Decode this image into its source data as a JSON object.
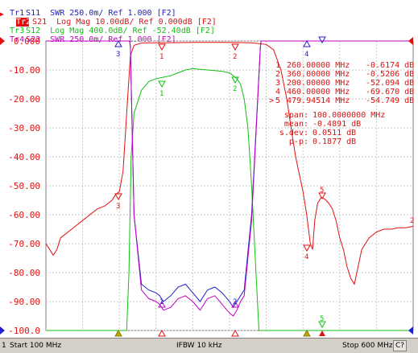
{
  "traces": [
    {
      "id": "Tr1",
      "text": "S11  SWR 250.0m/ Ref 1.000 [F2]",
      "color": "#2020d0",
      "active": false
    },
    {
      "id": "Tr2",
      "text": "S21  Log Mag 10.00dB/ Ref 0.000dB [F2]",
      "color": "#e01010",
      "active": true
    },
    {
      "id": "Tr3",
      "text": "S12  Log Mag 400.0dB/ Ref -52.40dB [F2]",
      "color": "#10c010",
      "active": false
    },
    {
      "id": "Tr4",
      "text": "S22  SWR 250.0m/ Ref 1.000 [F2]",
      "color": "#c000c0",
      "active": false
    }
  ],
  "y_axis": {
    "labels": [
      "0.000",
      "-10.00",
      "-20.00",
      "-30.00",
      "-40.00",
      "-50.00",
      "-60.00",
      "-70.00",
      "-80.00",
      "-90.00",
      "-100.0"
    ],
    "values": [
      0,
      -10,
      -20,
      -30,
      -40,
      -50,
      -60,
      -70,
      -80,
      -90,
      -100
    ]
  },
  "markers": [
    {
      "num": "1",
      "freq": "260.00000 MHz",
      "value": "-0.6174 dB",
      "prefix": ""
    },
    {
      "num": "2",
      "freq": "360.00000 MHz",
      "value": "-0.5206 dB",
      "prefix": ""
    },
    {
      "num": "3",
      "freq": "200.00000 MHz",
      "value": "-52.094 dB",
      "prefix": ""
    },
    {
      "num": "4",
      "freq": "460.00000 MHz",
      "value": "-69.670 dB",
      "prefix": ""
    },
    {
      "num": "5",
      "freq": "479.94514 MHz",
      "value": "-54.749 dB",
      "prefix": ">"
    }
  ],
  "stats": [
    {
      "label": "span:",
      "value": "100.0000000 MHz"
    },
    {
      "label": "mean:",
      "value": "-0.4891 dB"
    },
    {
      "label": "s.dev:",
      "value": "0.0511 dB"
    },
    {
      "label": "p-p:",
      "value": "0.1877 dB"
    }
  ],
  "chart_data": {
    "type": "line",
    "xlim": [
      100,
      600
    ],
    "ylim": [
      -100,
      0
    ],
    "series": [
      {
        "name": "Tr2 S21",
        "color": "#e01010",
        "x": [
          100,
          105,
          110,
          115,
          120,
          125,
          130,
          140,
          150,
          160,
          170,
          180,
          190,
          195,
          200,
          205,
          210,
          215,
          220,
          230,
          240,
          250,
          260,
          280,
          300,
          320,
          340,
          360,
          380,
          400,
          410,
          420,
          428,
          435,
          440,
          445,
          450,
          455,
          460,
          463,
          466,
          470,
          475,
          480,
          485,
          490,
          495,
          500,
          505,
          510,
          515,
          520,
          525,
          530,
          540,
          550,
          560,
          570,
          580,
          590,
          600
        ],
        "y": [
          -70,
          -72,
          -74,
          -72,
          -68,
          -67,
          -66,
          -64,
          -62,
          -60,
          -58,
          -57,
          -55,
          -53,
          -52,
          -45,
          -25,
          -5,
          -1.5,
          -0.7,
          -0.6,
          -0.6,
          -0.62,
          -0.55,
          -0.5,
          -0.5,
          -0.5,
          -0.52,
          -0.6,
          -1.2,
          -3,
          -10,
          -20,
          -32,
          -40,
          -46,
          -52,
          -60,
          -70,
          -72,
          -62,
          -56,
          -54,
          -54.7,
          -56,
          -58,
          -62,
          -68,
          -72,
          -78,
          -82,
          -84,
          -78,
          -72,
          -68,
          -66,
          -65,
          -65,
          -64.5,
          -64.5,
          -64
        ]
      },
      {
        "name": "Tr3 S12",
        "color": "#10c010",
        "x": [
          100,
          210,
          213,
          216,
          220,
          230,
          240,
          250,
          260,
          270,
          280,
          290,
          300,
          310,
          320,
          330,
          340,
          350,
          360,
          365,
          370,
          375,
          380,
          385,
          390,
          400,
          420,
          440,
          460,
          480,
          500,
          520,
          540,
          560,
          580,
          600
        ],
        "y": [
          -100,
          -100,
          -80,
          -40,
          -25,
          -17,
          -14,
          -13,
          -12.5,
          -12,
          -11,
          -10,
          -9.5,
          -9.8,
          -10,
          -10.2,
          -10.5,
          -11,
          -13,
          -15,
          -20,
          -30,
          -50,
          -75,
          -100,
          -100,
          -100,
          -100,
          -100,
          -100,
          -100,
          -100,
          -100,
          -100,
          -100,
          -100
        ]
      },
      {
        "name": "Tr1 S11",
        "color": "#2020d0",
        "x": [
          100,
          214,
          215,
          220,
          230,
          240,
          250,
          255,
          260,
          270,
          280,
          290,
          300,
          310,
          320,
          330,
          340,
          350,
          355,
          360,
          365,
          370,
          380,
          392,
          393,
          600
        ],
        "y": [
          0,
          0,
          -2,
          -60,
          -84,
          -86,
          -87,
          -88,
          -90,
          -88,
          -85,
          -84,
          -87,
          -90,
          -86,
          -85,
          -87,
          -90,
          -92,
          -90,
          -88,
          -86,
          -60,
          -2,
          0,
          0
        ]
      },
      {
        "name": "Tr4 S22",
        "color": "#c000c0",
        "x": [
          100,
          214,
          215,
          220,
          230,
          240,
          250,
          255,
          260,
          270,
          280,
          290,
          300,
          310,
          320,
          330,
          340,
          350,
          355,
          360,
          365,
          370,
          380,
          392,
          393,
          600
        ],
        "y": [
          0,
          0,
          -2,
          -60,
          -86,
          -89,
          -90,
          -91,
          -93,
          -92,
          -89,
          -88,
          -90,
          -93,
          -89,
          -88,
          -91,
          -94,
          -95,
          -93,
          -90,
          -88,
          -62,
          -2,
          0,
          0
        ]
      }
    ]
  },
  "marker_tags": {
    "m1": "1",
    "m2": "2",
    "m3": "3",
    "m4": "4",
    "m5": "5",
    "right_ref": "2"
  },
  "status": {
    "channel": "1",
    "start": "Start 100 MHz",
    "ifbw": "IFBW 10 kHz",
    "stop": "Stop 600 MHz",
    "cal": "C?"
  }
}
